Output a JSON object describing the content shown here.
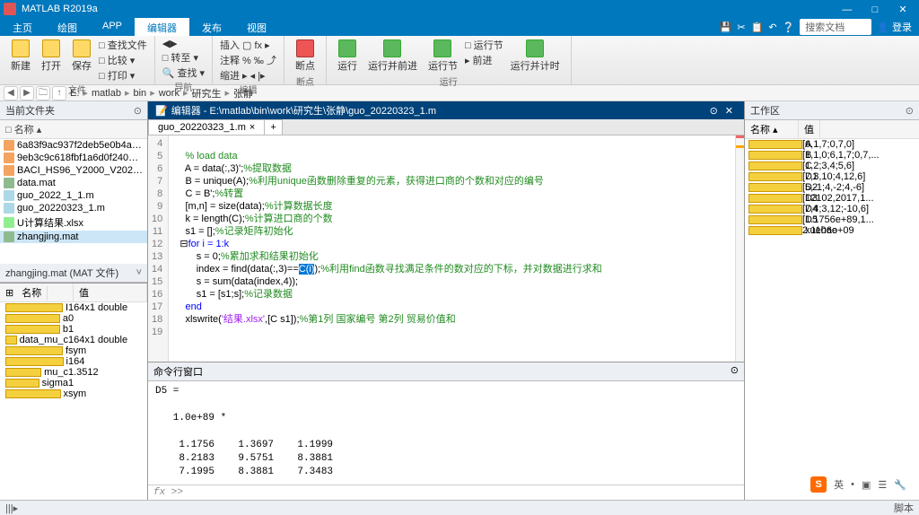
{
  "window": {
    "title": "MATLAB R2019a",
    "min": "—",
    "max": "□",
    "close": "✕"
  },
  "tabs": {
    "items": [
      "主页",
      "绘图",
      "APP",
      "编辑器",
      "发布",
      "视图"
    ],
    "active": 3
  },
  "toolbar_right": {
    "search_ph": "搜索文档",
    "login": "登录"
  },
  "ribbon": {
    "groups": [
      {
        "label": "文件",
        "big": [
          "新建",
          "打开",
          "保存"
        ],
        "small": [
          "□ 查找文件",
          "□ 比较 ▾",
          "□ 打印 ▾"
        ]
      },
      {
        "label": "导航",
        "big": [],
        "small": [
          "◀▶",
          "□ 转至 ▾",
          "🔍 查找 ▾"
        ]
      },
      {
        "label": "编辑",
        "big": [
          "插入",
          "注释",
          "缩进"
        ],
        "small": [
          "▢ fx ▸",
          "% ‰ ⤴",
          "▸ ◂ |▸"
        ]
      },
      {
        "label": "断点",
        "big": [
          "断点"
        ],
        "small": []
      },
      {
        "label": "运行",
        "big": [
          "运行",
          "运行并前进",
          "运行节",
          "运行并计时"
        ],
        "small": [
          "□ 运行节",
          "▸ 前进"
        ]
      }
    ]
  },
  "path": {
    "nav": [
      "◀",
      "▶",
      "🗀",
      "↑"
    ],
    "crumbs": [
      "E:",
      "matlab",
      "bin",
      "work",
      "研究生",
      "张静"
    ]
  },
  "current_folder": {
    "title": "当前文件夹",
    "header": "名称 ▴",
    "items": [
      {
        "ico": "csv",
        "name": "6a83f9ac937f2deb5e0b4a2d10421..."
      },
      {
        "ico": "csv",
        "name": "9eb3c9c618fbf1a6d0f240be34f47b..."
      },
      {
        "ico": "csv",
        "name": "BACI_HS96_Y2000_V202201.csv"
      },
      {
        "ico": "mat",
        "name": "data.mat"
      },
      {
        "ico": "m",
        "name": "guo_2022_1_1.m"
      },
      {
        "ico": "m",
        "name": "guo_20220323_1.m"
      },
      {
        "ico": "xlsx",
        "name": "U计算结果.xlsx"
      },
      {
        "ico": "mat",
        "name": "zhangjing.mat",
        "sel": true
      }
    ]
  },
  "details": {
    "title": "zhangjing.mat  (MAT 文件)",
    "cols": [
      "名称",
      "值"
    ],
    "rows": [
      [
        "I",
        "164x1 double"
      ],
      [
        "a",
        "0"
      ],
      [
        "b",
        "1"
      ],
      [
        "data_mu_c",
        "164x1 double"
      ],
      [
        "f",
        "sym"
      ],
      [
        "i",
        "164"
      ],
      [
        "mu_c",
        "1.3512"
      ],
      [
        "sigma",
        "1"
      ],
      [
        "x",
        "sym"
      ]
    ]
  },
  "editor": {
    "title": "编辑器 - E:\\matlab\\bin\\work\\研究生\\张静\\guo_20220323_1.m",
    "tab": "guo_20220323_1.m",
    "close_x": "×",
    "tab_plus": "+",
    "lines": [
      4,
      5,
      6,
      7,
      8,
      9,
      10,
      11,
      12,
      13,
      14,
      15,
      16,
      17,
      18,
      19
    ],
    "code": {
      "l4": "    % load data",
      "l5a": "    A = data(:,3)';",
      "l5c": "%提取数据",
      "l6a": "    B = unique(A);",
      "l6c": "%利用unique函数删除重复的元素，获得进口商的个数和对应的编号",
      "l7a": "    C = B';",
      "l7c": "%转置",
      "l8a": "    [m,n] = size(data);",
      "l8c": "%计算数据长度",
      "l9a": "    k = length(C);",
      "l9c": "%计算进口商的个数",
      "l10a": "    s1 = [];",
      "l10c": "%记录矩阵初始化",
      "l11": "for i = 1:k",
      "l12a": "        s = 0;",
      "l12c": "%累加求和结果初始化",
      "l13a": "        index = find(data(:,3)==",
      "l13h": "C(i)",
      "l13b": ");",
      "l13c": "%利用find函数寻找满足条件的数对应的下标，并对数据进行求和",
      "l14": "        s = sum(data(index,4));",
      "l15a": "        s1 = [s1;s];",
      "l15c": "%记录数据",
      "l16": "end",
      "l17a": "    xlswrite(",
      "l17s": "'结果.xlsx'",
      "l17b": ",[C s1]);",
      "l17c": "%第1列 国家编号 第2列 贸易价值和"
    }
  },
  "cmd": {
    "title": "命令行窗口",
    "out": "D5 =\n\n   1.0e+89 *\n\n    1.1756    1.3697    1.1999\n    8.2183    9.5751    8.3881\n    7.1995    8.3881    7.3483",
    "prompt": "fx >>"
  },
  "workspace": {
    "title": "工作区",
    "cols": [
      "名称 ▴",
      "值"
    ],
    "rows": [
      [
        "A",
        "[6,1,7;0,7,0]"
      ],
      [
        "B",
        "[1,1,0;6,1,7;0,7,..."
      ],
      [
        "C",
        "[1,2;3,4;5,6]"
      ],
      [
        "D1",
        "[7,3,10;4,12,6]"
      ],
      [
        "D2",
        "[5,-1;4,-2;4,-6]"
      ],
      [
        "D3",
        "[12102,2017,1..."
      ],
      [
        "D4",
        "[7,4;3,12;-10,6]"
      ],
      [
        "D5",
        "[1.1756e+89,1..."
      ],
      [
        "xuehao",
        "2.1106e+09"
      ]
    ]
  },
  "status": {
    "left": "|||▸",
    "right": "脚本"
  },
  "ime": {
    "logo": "S",
    "items": [
      "英",
      "•",
      "▣",
      "☰",
      "🔧"
    ]
  }
}
